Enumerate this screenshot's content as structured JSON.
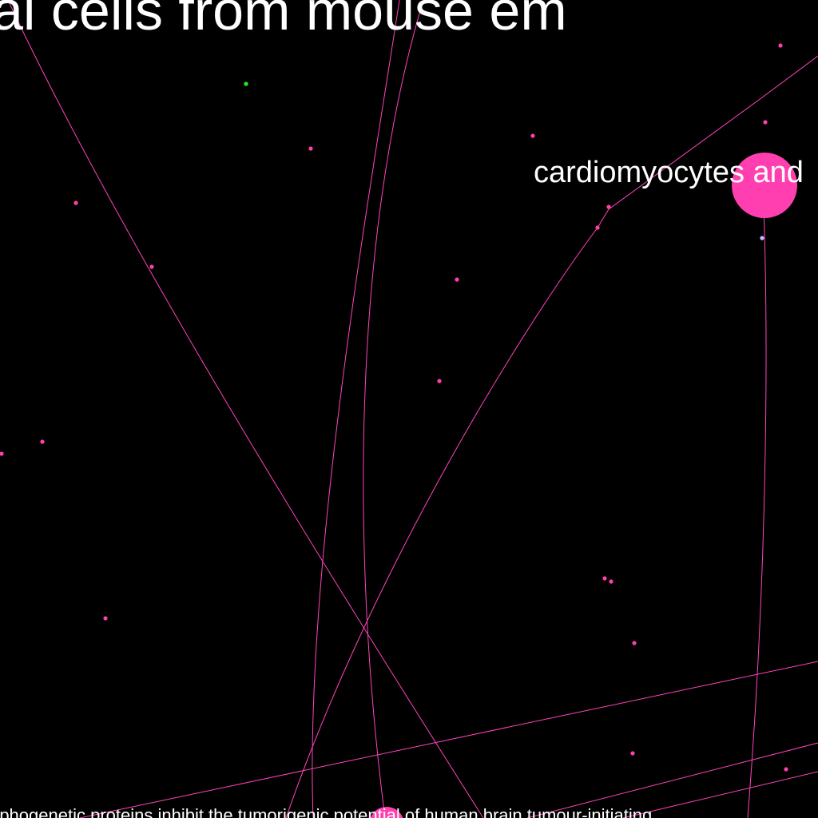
{
  "colors": {
    "background": "#000000",
    "edge": "#ff44bb",
    "node": "#ff3fb0",
    "node_green": "#22ee22",
    "node_lavender": "#ccbbff",
    "label": "#ffffff"
  },
  "labels": {
    "top": "al cells from mouse em",
    "cardio": "cardiomyocytes and",
    "bottom": "rphogenetic proteins inhibit the tumorigenic potential of human brain tumour-initiating"
  }
}
